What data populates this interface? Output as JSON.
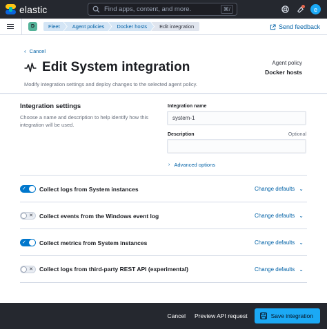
{
  "topbar": {
    "brand": "elastic",
    "search_placeholder": "Find apps, content, and more.",
    "search_shortcut": "⌘/",
    "avatar_letter": "e",
    "icons": [
      "help-icon",
      "newsfeed-icon",
      "avatar"
    ]
  },
  "subbar": {
    "space_letter": "D",
    "breadcrumbs": [
      "Fleet",
      "Agent policies",
      "Docker hosts",
      "Edit integration"
    ],
    "feedback_label": "Send feedback"
  },
  "header": {
    "cancel_label": "Cancel",
    "title": "Edit System integration",
    "description": "Modify integration settings and deploy changes to the selected agent policy.",
    "policy_label": "Agent policy",
    "policy_name": "Docker hosts"
  },
  "settings": {
    "title": "Integration settings",
    "description": "Choose a name and description to help identify how this integration will be used.",
    "name_label": "Integration name",
    "name_value": "system-1",
    "description_label": "Description",
    "description_optional": "Optional",
    "description_value": "",
    "advanced_label": "Advanced options"
  },
  "inputs": [
    {
      "label": "Collect logs from System instances",
      "enabled": true,
      "action": "Change defaults"
    },
    {
      "label": "Collect events from the Windows event log",
      "enabled": false,
      "action": "Change defaults"
    },
    {
      "label": "Collect metrics from System instances",
      "enabled": true,
      "action": "Change defaults"
    },
    {
      "label": "Collect logs from third-party REST API (experimental)",
      "enabled": false,
      "action": "Change defaults"
    }
  ],
  "bottombar": {
    "cancel_label": "Cancel",
    "preview_label": "Preview API request",
    "save_label": "Save integration"
  },
  "colors": {
    "accent": "#0077cc",
    "primary_button": "#1ba9f5",
    "topbar": "#25282f"
  }
}
